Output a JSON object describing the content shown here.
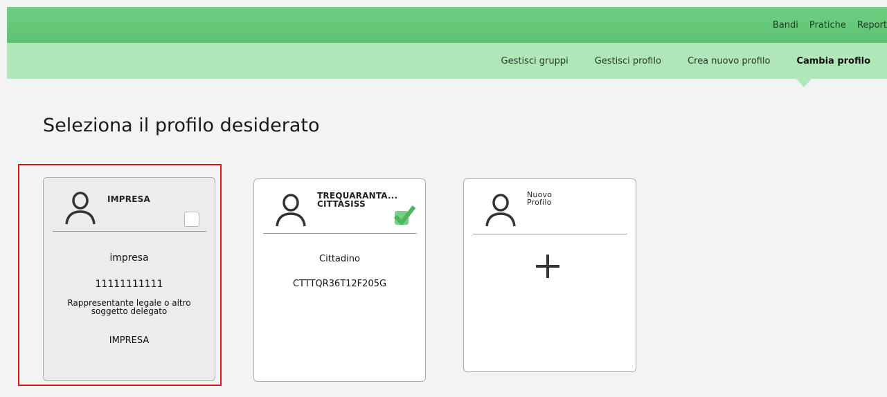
{
  "topnav": {
    "items": [
      "Bandi",
      "Pratiche",
      "Report"
    ]
  },
  "subnav": {
    "items": [
      "Gestisci gruppi",
      "Gestisci profilo",
      "Crea nuovo profilo",
      "Cambia profilo"
    ],
    "active": "Cambia profilo"
  },
  "page": {
    "title": "Seleziona il profilo desiderato"
  },
  "profiles": [
    {
      "header": "IMPRESA",
      "checked": false,
      "lines": [
        "impresa",
        "11111111111",
        "Rappresentante legale o altro soggetto delegato",
        "IMPRESA"
      ],
      "highlighted": true
    },
    {
      "header": "TREQUARANTA...\nCITTASISS",
      "checked": true,
      "lines": [
        "Cittadino",
        "CTTTQR36T12F205G"
      ]
    },
    {
      "header": "Nuovo\nProfilo",
      "icon": "plus-icon"
    }
  ],
  "colors": {
    "topbar": "#5cc271",
    "subbar": "#b1e6b9",
    "check": "#5cbf6c",
    "highlight": "#e01515"
  }
}
